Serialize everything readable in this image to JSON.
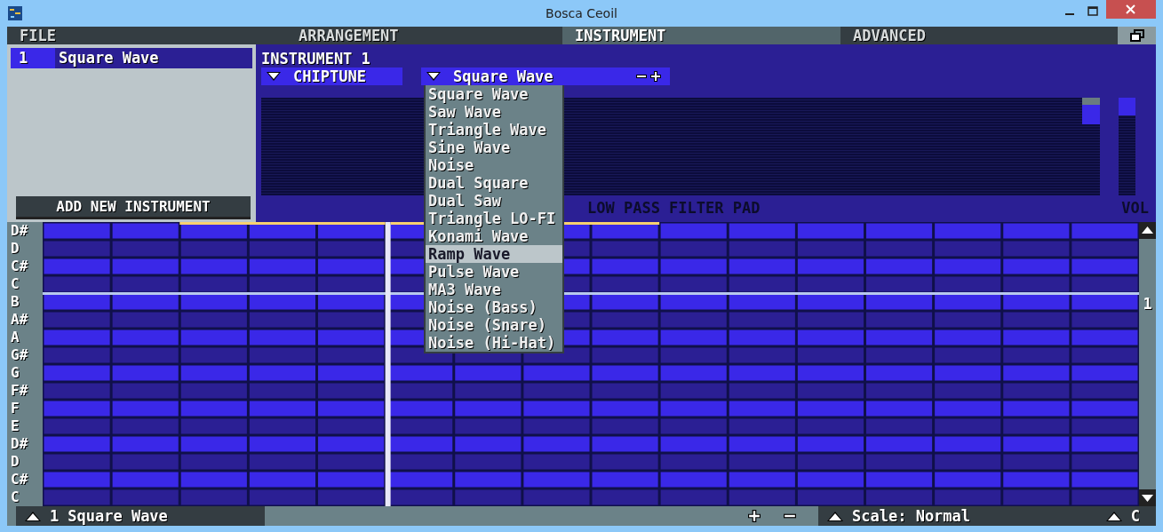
{
  "window": {
    "title": "Bosca Ceoil"
  },
  "menu_tabs": [
    {
      "label": "FILE",
      "selected": false
    },
    {
      "label": "ARRANGEMENT",
      "selected": false
    },
    {
      "label": "INSTRUMENT",
      "selected": true
    },
    {
      "label": "ADVANCED",
      "selected": false
    }
  ],
  "instruments": [
    {
      "number": "1",
      "name": "Square Wave",
      "selected": true
    }
  ],
  "add_instrument_button": "ADD NEW INSTRUMENT",
  "instrument_panel": {
    "title": "INSTRUMENT 1",
    "category": "CHIPTUNE",
    "voice": "Square Wave",
    "voice_options": [
      {
        "label": "Square Wave",
        "selected": false
      },
      {
        "label": "Saw Wave",
        "selected": false
      },
      {
        "label": "Triangle Wave",
        "selected": false
      },
      {
        "label": "Sine Wave",
        "selected": false
      },
      {
        "label": "Noise",
        "selected": false
      },
      {
        "label": "Dual Square",
        "selected": false
      },
      {
        "label": "Dual Saw",
        "selected": false
      },
      {
        "label": "Triangle LO-FI",
        "selected": false
      },
      {
        "label": "Konami Wave",
        "selected": false
      },
      {
        "label": "Ramp Wave",
        "selected": true
      },
      {
        "label": "Pulse Wave",
        "selected": false
      },
      {
        "label": "MA3 Wave",
        "selected": false
      },
      {
        "label": "Noise (Bass)",
        "selected": false
      },
      {
        "label": "Noise (Snare)",
        "selected": false
      },
      {
        "label": "Noise (Hi-Hat)",
        "selected": false
      }
    ],
    "filter_label": "LOW PASS FILTER PAD",
    "volume_label": "VOL",
    "volume": {
      "level": 1
    }
  },
  "note_labels": [
    "D#",
    "D",
    "C#",
    "C",
    "B",
    "A#",
    "A",
    "G#",
    "G",
    "F#",
    "F",
    "E",
    "D#",
    "D",
    "C#",
    "C"
  ],
  "octave_marker": "1",
  "status_bar": {
    "instrument_number": "1",
    "instrument_name": "Square Wave",
    "scale": "Scale: Normal",
    "key": "C"
  }
}
